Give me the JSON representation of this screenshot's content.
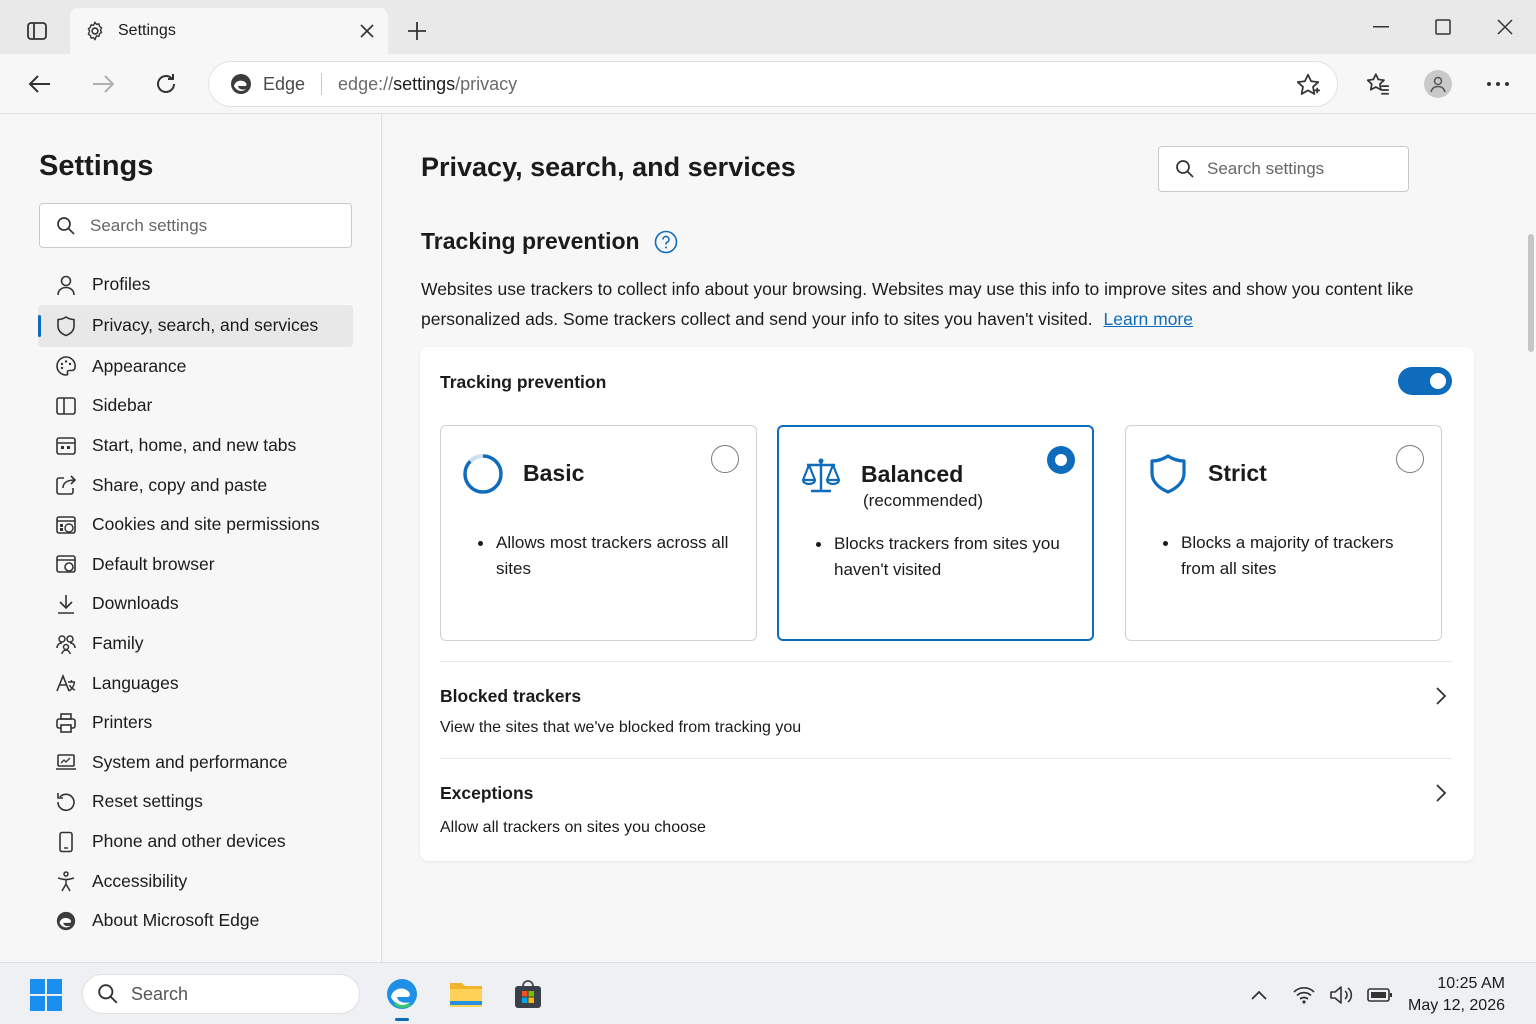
{
  "window": {
    "tab_title": "Settings",
    "address_site": "Edge",
    "address_url_prefix": "edge://",
    "address_url_host": "settings",
    "address_url_path": "/privacy"
  },
  "sidebar": {
    "title": "Settings",
    "search_placeholder": "Search settings",
    "items": [
      {
        "label": "Profiles",
        "icon": "person-icon"
      },
      {
        "label": "Privacy, search, and services",
        "icon": "shield-icon",
        "active": true
      },
      {
        "label": "Appearance",
        "icon": "palette-icon"
      },
      {
        "label": "Sidebar",
        "icon": "sidebar-icon"
      },
      {
        "label": "Start, home, and new tabs",
        "icon": "home-tabs-icon"
      },
      {
        "label": "Share, copy and paste",
        "icon": "share-icon"
      },
      {
        "label": "Cookies and site permissions",
        "icon": "cookie-icon"
      },
      {
        "label": "Default browser",
        "icon": "browser-icon"
      },
      {
        "label": "Downloads",
        "icon": "download-icon"
      },
      {
        "label": "Family",
        "icon": "family-icon"
      },
      {
        "label": "Languages",
        "icon": "languages-icon"
      },
      {
        "label": "Printers",
        "icon": "printer-icon"
      },
      {
        "label": "System and performance",
        "icon": "laptop-icon"
      },
      {
        "label": "Reset settings",
        "icon": "reset-icon"
      },
      {
        "label": "Phone and other devices",
        "icon": "phone-icon"
      },
      {
        "label": "Accessibility",
        "icon": "accessibility-icon"
      },
      {
        "label": "About Microsoft Edge",
        "icon": "edge-logo-icon"
      }
    ]
  },
  "main": {
    "page_title": "Privacy, search, and services",
    "search_placeholder": "Search settings",
    "section_title": "Tracking prevention",
    "description": "Websites use trackers to collect info about your browsing. Websites may use this info to improve sites and show you content like personalized ads. Some trackers collect and send your info to sites you haven't visited.",
    "learn_more": "Learn more",
    "card": {
      "heading": "Tracking prevention",
      "toggle_on": true,
      "options": [
        {
          "name": "Basic",
          "subtitle": "",
          "bullet": "Allows most trackers across all sites",
          "selected": false
        },
        {
          "name": "Balanced",
          "subtitle": "(recommended)",
          "bullet": "Blocks trackers from sites you haven't visited",
          "selected": true
        },
        {
          "name": "Strict",
          "subtitle": "",
          "bullet": "Blocks a majority of trackers from all sites",
          "selected": false
        }
      ],
      "rows": [
        {
          "title": "Blocked trackers",
          "description": "View the sites that we've blocked from tracking you"
        },
        {
          "title": "Exceptions",
          "description": "Allow all trackers on sites you choose"
        }
      ]
    }
  },
  "taskbar": {
    "search_placeholder": "Search",
    "time": "10:25 AM",
    "date": "May 12, 2026"
  },
  "colors": {
    "accent": "#0f6cbd"
  }
}
